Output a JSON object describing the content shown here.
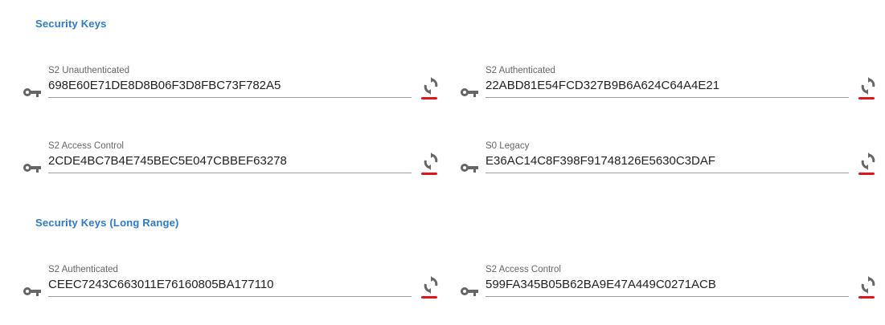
{
  "sections": [
    {
      "title": "Security Keys",
      "fields": [
        {
          "label": "S2 Unauthenticated",
          "value": "698E60E71DE8D8B06F3D8FBC73F782A5"
        },
        {
          "label": "S2 Authenticated",
          "value": "22ABD81E54FCD327B9B6A624C64A4E21"
        },
        {
          "label": "S2 Access Control",
          "value": "2CDE4BC7B4E745BEC5E047CBBEF63278"
        },
        {
          "label": "S0 Legacy",
          "value": "E36AC14C8F398F91748126E5630C3DAF"
        }
      ]
    },
    {
      "title": "Security Keys (Long Range)",
      "fields": [
        {
          "label": "S2 Authenticated",
          "value": "CEEC7243C663011E76160805BA177110"
        },
        {
          "label": "S2 Access Control",
          "value": "599FA345B05B62BA9E47A449C0271ACB"
        }
      ]
    }
  ],
  "icons": {
    "field_icon": "key-icon",
    "action_icon": "regenerate-icon"
  },
  "colors": {
    "section_title": "#2a7ad1",
    "underline_accent": "#e2141b",
    "field_border": "#9e9e9e",
    "icon": "#666666"
  }
}
